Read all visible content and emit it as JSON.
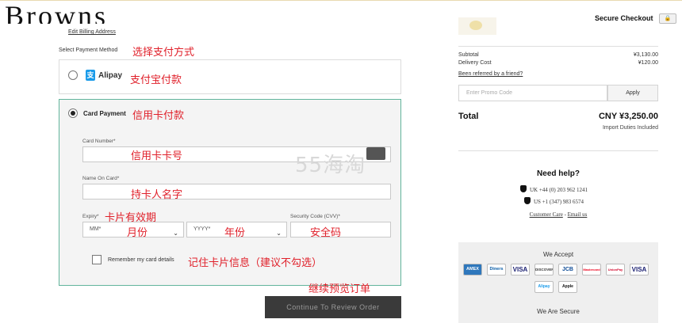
{
  "brand": {
    "logo": "Browns"
  },
  "header": {
    "secure_checkout": "Secure Checkout"
  },
  "billing": {
    "edit_link": "Edit Billing Address"
  },
  "payment": {
    "section_label": "Select Payment Method",
    "alipay": {
      "icon_char": "支",
      "label": "Alipay"
    },
    "card": {
      "label": "Card Payment",
      "card_number_label": "Card Number*",
      "name_label": "Name On Card*",
      "expiry_label": "Expiry*",
      "month_value": "MM*",
      "year_value": "YYYY*",
      "cvv_label": "Security Code (CVV)*",
      "remember_label": "Remember my card details"
    },
    "review_button": "Continue To Review Order"
  },
  "annotations": {
    "select_method": "选择支付方式",
    "alipay": "支付宝付款",
    "card_payment": "信用卡付款",
    "card_number": "信用卡卡号",
    "cardholder": "持卡人名字",
    "expiry": "卡片有效期",
    "month": "月份",
    "year": "年份",
    "cvv": "安全码",
    "remember": "记住卡片信息（建议不勾选）",
    "continue": "继续预览订单"
  },
  "watermark": "55海淘",
  "summary": {
    "subtotal_label": "Subtotal",
    "subtotal_value": "¥3,130.00",
    "delivery_label": "Delivery Cost",
    "delivery_value": "¥120.00",
    "referral_link": "Been referred by a friend?",
    "promo_placeholder": "Enter Promo Code",
    "apply_button": "Apply",
    "total_label": "Total",
    "total_value": "CNY ¥3,250.00",
    "duties_note": "Import Duties Included"
  },
  "help": {
    "title": "Need help?",
    "phone_uk": "UK +44 (0) 203 962 1241",
    "phone_us": "US +1 (347) 983 6574",
    "customer_care": "Customer Care",
    "separator": " - ",
    "email": "Email us"
  },
  "accept": {
    "title": "We Accept",
    "methods": [
      "AMEX",
      "Diners",
      "VISA",
      "DISCOVER",
      "JCB",
      "Mastercard",
      "UnionPay",
      "VISA",
      "Alipay",
      "Apple Pay"
    ]
  },
  "secure": {
    "title": "We Are Secure"
  },
  "colors": {
    "accent_green": "#62b59c",
    "annotation_red": "#e0202a",
    "button_dark": "#3a3a3a"
  }
}
